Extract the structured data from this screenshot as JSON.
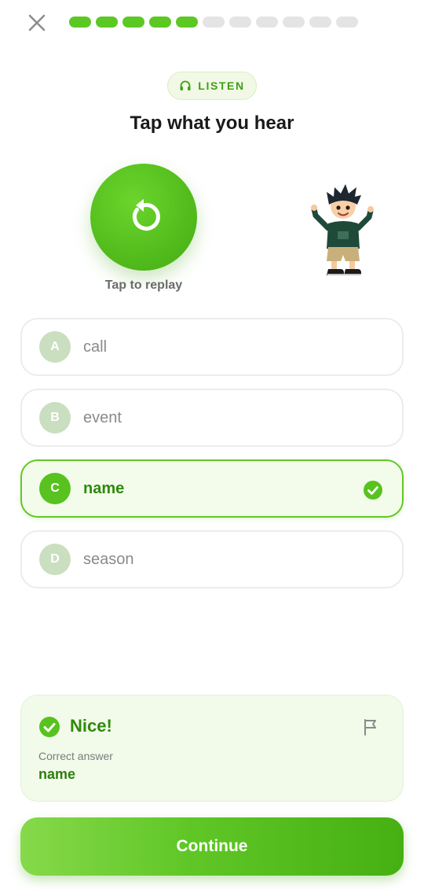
{
  "header": {
    "close_icon": "close-icon",
    "progress": {
      "completed": 5,
      "total": 11
    }
  },
  "badge": {
    "label": "LISTEN",
    "icon": "headphones-icon"
  },
  "prompt": {
    "title": "Tap what you hear"
  },
  "replay": {
    "caption": "Tap to replay",
    "icon": "replay-icon"
  },
  "options": [
    {
      "letter": "A",
      "word": "call",
      "selected": false
    },
    {
      "letter": "B",
      "word": "event",
      "selected": false
    },
    {
      "letter": "C",
      "word": "name",
      "selected": true
    },
    {
      "letter": "D",
      "word": "season",
      "selected": false
    }
  ],
  "feedback": {
    "title": "Nice!",
    "label": "Correct answer",
    "answer": "name",
    "icon": "check-circle-icon",
    "flag_icon": "flag-icon"
  },
  "continue_button": {
    "label": "Continue"
  },
  "colors": {
    "accent_green": "#5cc823",
    "dark_green_text": "#2e8a0b",
    "progress_empty": "#e4e4e4"
  }
}
